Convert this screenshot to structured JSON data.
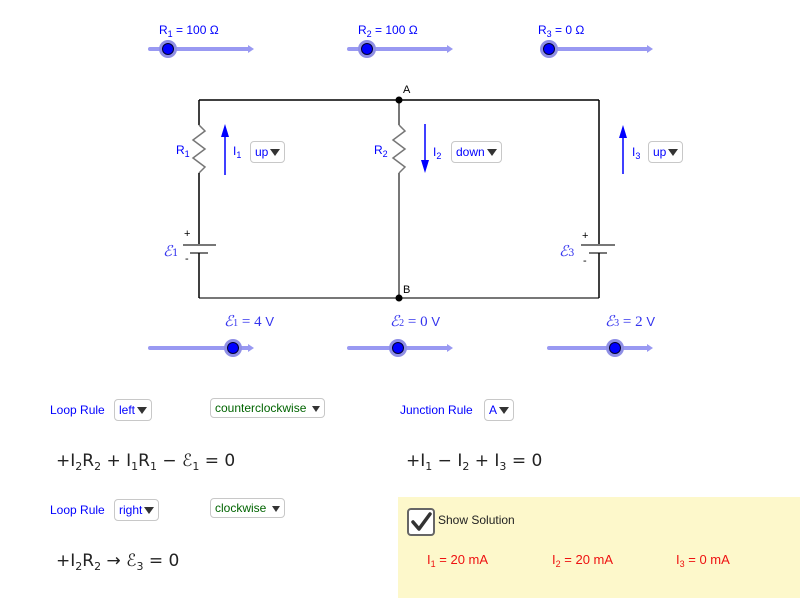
{
  "sliders": {
    "resistors": [
      {
        "name": "R",
        "index": "1",
        "value": "100",
        "unit": "Ω",
        "fraction": 0.2
      },
      {
        "name": "R",
        "index": "2",
        "value": "100",
        "unit": "Ω",
        "fraction": 0.2
      },
      {
        "name": "R",
        "index": "3",
        "value": "0",
        "unit": "Ω",
        "fraction": 0.0
      }
    ],
    "emfs": [
      {
        "index": "1",
        "value": "4",
        "unit": "V",
        "fraction": 0.83
      },
      {
        "index": "2",
        "value": "0",
        "unit": "V",
        "fraction": 0.5
      },
      {
        "index": "3",
        "value": "2",
        "unit": "V",
        "fraction": 0.67
      }
    ]
  },
  "circuit": {
    "node_a": "A",
    "node_b": "B",
    "resistor_labels": [
      {
        "name": "R",
        "index": "1"
      },
      {
        "name": "R",
        "index": "2"
      }
    ],
    "battery_labels": [
      {
        "symbol": "ℰ",
        "index": "1"
      },
      {
        "symbol": "ℰ",
        "index": "3"
      }
    ],
    "plus": "+",
    "minus": "-",
    "currents": [
      {
        "name": "I",
        "index": "1",
        "direction": "up"
      },
      {
        "name": "I",
        "index": "2",
        "direction": "down"
      },
      {
        "name": "I",
        "index": "3",
        "direction": "up"
      }
    ],
    "colors": {
      "wire": "#000000",
      "component": "#777777",
      "label": "#0000ff",
      "arrow": "#0000ff"
    }
  },
  "loop_rules": [
    {
      "label": "Loop Rule",
      "loop": "left",
      "orientation": "counterclockwise",
      "equation": {
        "t1": "+I",
        "s1": "2",
        "t2": "R",
        "s2": "2",
        "t3": " + I",
        "s3": "1",
        "t4": "R",
        "s4": "1",
        "t5": " − ℰ",
        "s5": "1",
        "t6": " = 0"
      }
    },
    {
      "label": "Loop Rule",
      "loop": "right",
      "orientation": "clockwise",
      "equation": {
        "t1": "+I",
        "s1": "2",
        "t2": "R",
        "s2": "2",
        "t3": " → ℰ",
        "s3": "3",
        "t4": " = 0"
      }
    }
  ],
  "junction_rule": {
    "label": "Junction Rule",
    "node": "A",
    "equation": {
      "t1": "+I",
      "s1": "1",
      "t2": " − I",
      "s2": "2",
      "t3": " + I",
      "s3": "3",
      "t4": " = 0"
    }
  },
  "solution": {
    "checkbox_label": "Show Solution",
    "checked": true,
    "values": [
      {
        "name": "I",
        "index": "1",
        "value": "= 20 mA"
      },
      {
        "name": "I",
        "index": "2",
        "value": "= 20 mA"
      },
      {
        "name": "I",
        "index": "3",
        "value": "= 0 mA"
      }
    ],
    "background": "#fdf8cb",
    "text_color": "#ee1111"
  }
}
